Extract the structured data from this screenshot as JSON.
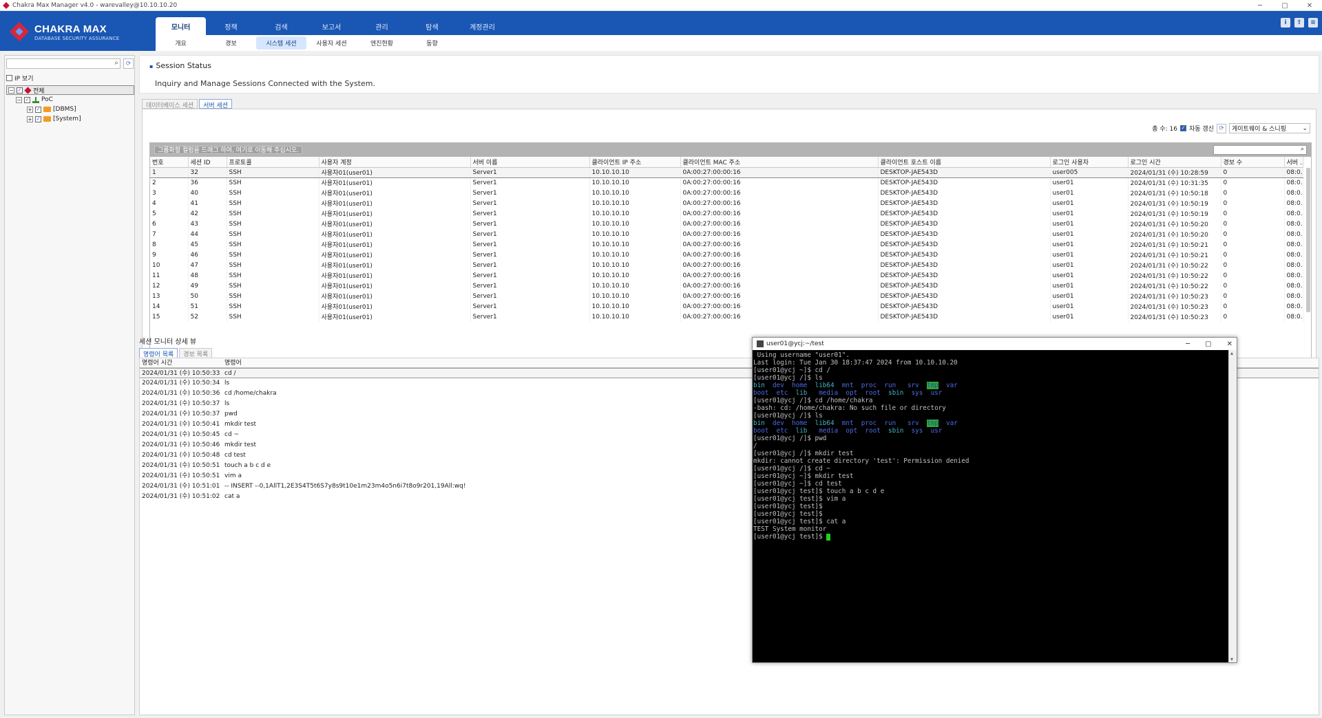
{
  "window": {
    "title": "Chakra Max Manager v4.0 - warevalley@10.10.10.20",
    "controls": [
      "─",
      "▢",
      "✕"
    ]
  },
  "logo": {
    "name": "CHAKRA MAX",
    "tagline": "DATABASE SECURITY ASSURANCE"
  },
  "main_tabs": [
    "모니터",
    "정책",
    "검색",
    "보고서",
    "관리",
    "탐색",
    "계정관리"
  ],
  "sub_tabs": [
    "개요",
    "경보",
    "시스템 세션",
    "사용자 세션",
    "엔진현황",
    "동향"
  ],
  "header_icons": [
    "i",
    "⇧",
    "≡"
  ],
  "left": {
    "search_placeholder": "",
    "ip_view": "IP 보기",
    "tree": [
      {
        "label": "전체",
        "level": 0
      },
      {
        "label": "PoC",
        "level": 1
      },
      {
        "label": "[DBMS]",
        "level": 2
      },
      {
        "label": "[System]",
        "level": 2
      }
    ]
  },
  "session_status": {
    "title": "Session Status",
    "description": "Inquiry and Manage Sessions Connected with the System."
  },
  "session_tabs": [
    "데이터베이스 세션",
    "서버 세션"
  ],
  "toolbar": {
    "total": "총 수: 16",
    "auto_refresh": "자동 갱신",
    "gateway": "게이트웨이 & 스니핑"
  },
  "grid": {
    "group_hint": "그룹화할 컬럼을 드래그 하여, 여기로 이동해 주십시오.",
    "columns": [
      "번호",
      "세션 ID",
      "프로토콜",
      "사용자 계정",
      "서버 이름",
      "클라이언트 IP 주소",
      "클라이언트 MAC 주소",
      "클라이언트 호스트 이름",
      "로그인 사용자",
      "로그인 시간",
      "경보 수",
      "서버 ..."
    ],
    "rows": [
      [
        "1",
        "32",
        "SSH",
        "사용자01(user01)",
        "Server1",
        "10.10.10.10",
        "0A:00:27:00:00:16",
        "DESKTOP-JAE543D",
        "user005",
        "2024/01/31 (수) 10:28:59",
        "0",
        "08:0..."
      ],
      [
        "2",
        "36",
        "SSH",
        "사용자01(user01)",
        "Server1",
        "10.10.10.10",
        "0A:00:27:00:00:16",
        "DESKTOP-JAE543D",
        "user01",
        "2024/01/31 (수) 10:31:35",
        "0",
        "08:0..."
      ],
      [
        "3",
        "40",
        "SSH",
        "사용자01(user01)",
        "Server1",
        "10.10.10.10",
        "0A:00:27:00:00:16",
        "DESKTOP-JAE543D",
        "user01",
        "2024/01/31 (수) 10:50:18",
        "0",
        "08:0..."
      ],
      [
        "4",
        "41",
        "SSH",
        "사용자01(user01)",
        "Server1",
        "10.10.10.10",
        "0A:00:27:00:00:16",
        "DESKTOP-JAE543D",
        "user01",
        "2024/01/31 (수) 10:50:19",
        "0",
        "08:0..."
      ],
      [
        "5",
        "42",
        "SSH",
        "사용자01(user01)",
        "Server1",
        "10.10.10.10",
        "0A:00:27:00:00:16",
        "DESKTOP-JAE543D",
        "user01",
        "2024/01/31 (수) 10:50:19",
        "0",
        "08:0..."
      ],
      [
        "6",
        "43",
        "SSH",
        "사용자01(user01)",
        "Server1",
        "10.10.10.10",
        "0A:00:27:00:00:16",
        "DESKTOP-JAE543D",
        "user01",
        "2024/01/31 (수) 10:50:20",
        "0",
        "08:0..."
      ],
      [
        "7",
        "44",
        "SSH",
        "사용자01(user01)",
        "Server1",
        "10.10.10.10",
        "0A:00:27:00:00:16",
        "DESKTOP-JAE543D",
        "user01",
        "2024/01/31 (수) 10:50:20",
        "0",
        "08:0..."
      ],
      [
        "8",
        "45",
        "SSH",
        "사용자01(user01)",
        "Server1",
        "10.10.10.10",
        "0A:00:27:00:00:16",
        "DESKTOP-JAE543D",
        "user01",
        "2024/01/31 (수) 10:50:21",
        "0",
        "08:0..."
      ],
      [
        "9",
        "46",
        "SSH",
        "사용자01(user01)",
        "Server1",
        "10.10.10.10",
        "0A:00:27:00:00:16",
        "DESKTOP-JAE543D",
        "user01",
        "2024/01/31 (수) 10:50:21",
        "0",
        "08:0..."
      ],
      [
        "10",
        "47",
        "SSH",
        "사용자01(user01)",
        "Server1",
        "10.10.10.10",
        "0A:00:27:00:00:16",
        "DESKTOP-JAE543D",
        "user01",
        "2024/01/31 (수) 10:50:22",
        "0",
        "08:0..."
      ],
      [
        "11",
        "48",
        "SSH",
        "사용자01(user01)",
        "Server1",
        "10.10.10.10",
        "0A:00:27:00:00:16",
        "DESKTOP-JAE543D",
        "user01",
        "2024/01/31 (수) 10:50:22",
        "0",
        "08:0..."
      ],
      [
        "12",
        "49",
        "SSH",
        "사용자01(user01)",
        "Server1",
        "10.10.10.10",
        "0A:00:27:00:00:16",
        "DESKTOP-JAE543D",
        "user01",
        "2024/01/31 (수) 10:50:22",
        "0",
        "08:0..."
      ],
      [
        "13",
        "50",
        "SSH",
        "사용자01(user01)",
        "Server1",
        "10.10.10.10",
        "0A:00:27:00:00:16",
        "DESKTOP-JAE543D",
        "user01",
        "2024/01/31 (수) 10:50:23",
        "0",
        "08:0..."
      ],
      [
        "14",
        "51",
        "SSH",
        "사용자01(user01)",
        "Server1",
        "10.10.10.10",
        "0A:00:27:00:00:16",
        "DESKTOP-JAE543D",
        "user01",
        "2024/01/31 (수) 10:50:23",
        "0",
        "08:0..."
      ],
      [
        "15",
        "52",
        "SSH",
        "사용자01(user01)",
        "Server1",
        "10.10.10.10",
        "0A:00:27:00:00:16",
        "DESKTOP-JAE543D",
        "user01",
        "2024/01/31 (수) 10:50:23",
        "0",
        "08:0..."
      ]
    ]
  },
  "detail": {
    "title": "세션 모니터 상세 뷰",
    "tabs": [
      "명령어 목록",
      "경보 목록"
    ],
    "columns": [
      "명령어 시간",
      "명령어"
    ],
    "rows": [
      [
        "2024/01/31 (수) 10:50:33",
        "cd /"
      ],
      [
        "2024/01/31 (수) 10:50:34",
        "ls"
      ],
      [
        "2024/01/31 (수) 10:50:36",
        "cd /home/chakra"
      ],
      [
        "2024/01/31 (수) 10:50:37",
        "ls"
      ],
      [
        "2024/01/31 (수) 10:50:37",
        "pwd"
      ],
      [
        "2024/01/31 (수) 10:50:41",
        "mkdir test"
      ],
      [
        "2024/01/31 (수) 10:50:45",
        "cd ~"
      ],
      [
        "2024/01/31 (수) 10:50:46",
        "mkdir test"
      ],
      [
        "2024/01/31 (수) 10:50:48",
        "cd test"
      ],
      [
        "2024/01/31 (수) 10:50:51",
        "touch a b c d e"
      ],
      [
        "2024/01/31 (수) 10:50:51",
        "vim a"
      ],
      [
        "2024/01/31 (수) 10:51:01",
        "-- INSERT --0,1AllT1,2E3S4T5t6S7y8s9t10e1m23m4o5n6i7t8o9r201,19All:wq!"
      ],
      [
        "2024/01/31 (수) 10:51:02",
        "cat a"
      ]
    ]
  },
  "terminal": {
    "title": "user01@ycj:~/test",
    "lines": [
      " Using username \"user01\".",
      "Last login: Tue Jan 30 18:37:47 2024 from 10.10.10.20",
      "[user01@ycj ~]$ cd /",
      "[user01@ycj /]$ ls",
      "bin  dev  home  lib64  mnt  proc  run   srv  tmp  var",
      "boot  etc  lib   media  opt  root  sbin  sys  usr",
      "[user01@ycj /]$ cd /home/chakra",
      "-bash: cd: /home/chakra: No such file or directory",
      "[user01@ycj /]$ ls",
      "bin  dev  home  lib64  mnt  proc  run   srv  tmp  var",
      "boot  etc  lib   media  opt  root  sbin  sys  usr",
      "[user01@ycj /]$ pwd",
      "/",
      "[user01@ycj /]$ mkdir test",
      "mkdir: cannot create directory 'test': Permission denied",
      "[user01@ycj /]$ cd ~",
      "[user01@ycj ~]$ mkdir test",
      "[user01@ycj ~]$ cd test",
      "[user01@ycj test]$ touch a b c d e",
      "[user01@ycj test]$ vim a",
      "[user01@ycj test]$",
      "[user01@ycj test]$",
      "[user01@ycj test]$ cat a",
      "TEST System monitor",
      "[user01@ycj test]$ "
    ]
  },
  "colors": {
    "header_blue": "#1a56b3",
    "terminal_bg": "#000000",
    "cursor": "#20d020"
  }
}
